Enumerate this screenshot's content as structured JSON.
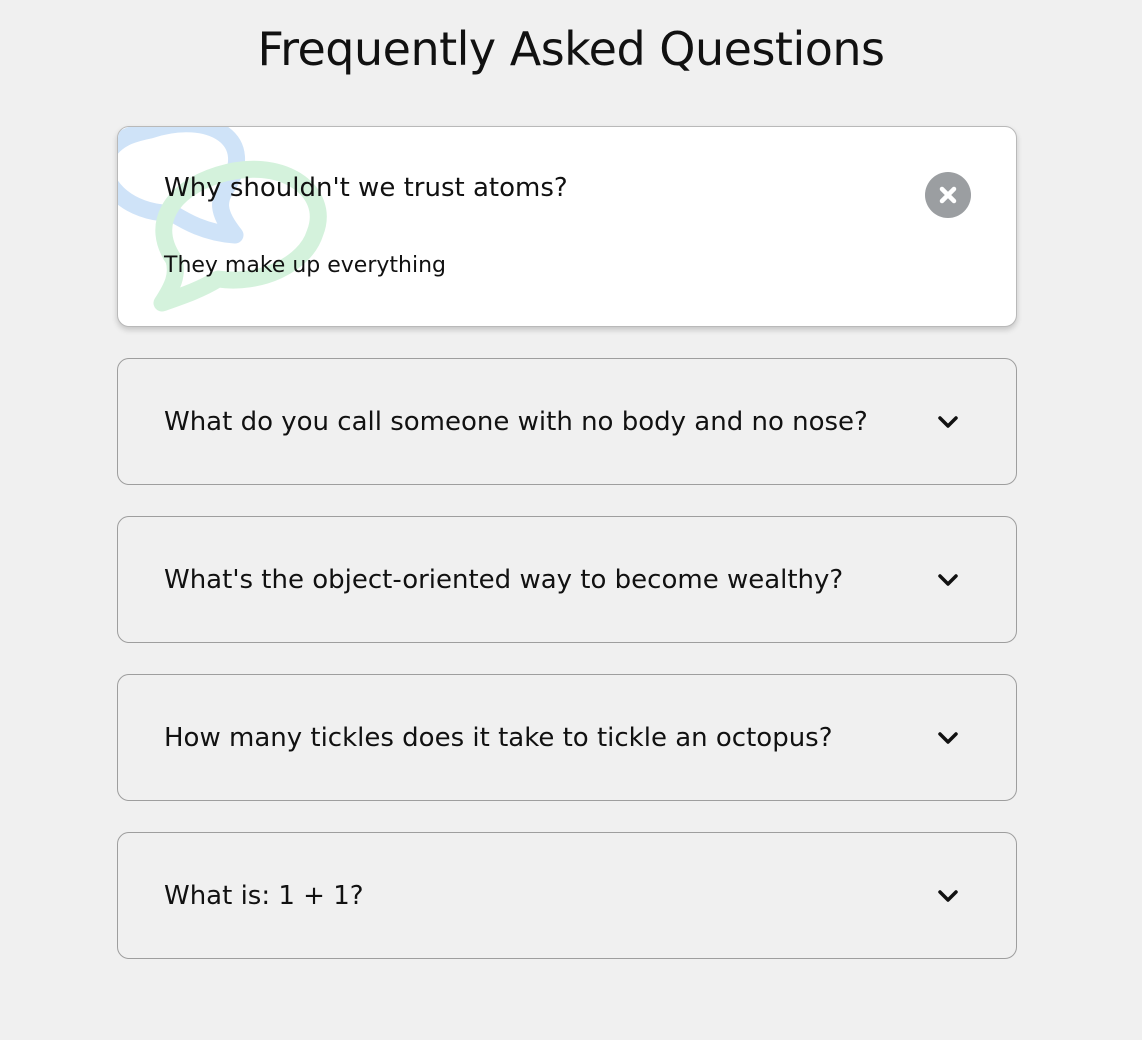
{
  "page": {
    "title": "Frequently Asked Questions"
  },
  "faqs": [
    {
      "question": "Why shouldn't we trust atoms?",
      "answer": "They make up everything",
      "expanded": true,
      "toggle_icon": "close-icon"
    },
    {
      "question": "What do you call someone with no body and no nose?",
      "expanded": false,
      "toggle_icon": "chevron-down-icon"
    },
    {
      "question": "What's the object-oriented way to become wealthy?",
      "expanded": false,
      "toggle_icon": "chevron-down-icon"
    },
    {
      "question": "How many tickles does it take to tickle an octopus?",
      "expanded": false,
      "toggle_icon": "chevron-down-icon"
    },
    {
      "question": "What is: 1 + 1?",
      "expanded": false,
      "toggle_icon": "chevron-down-icon"
    }
  ],
  "colors": {
    "page_background": "#f0f0f0",
    "active_card_background": "#ffffff",
    "card_border": "#9e9e9e",
    "close_button_background": "#9b9ea1",
    "bubble_blue": "#cfe3f8",
    "bubble_green": "#d4f2dc",
    "text": "#111111"
  },
  "decorations": {
    "active_card_background_icons": [
      "speech-bubble-icon",
      "speech-bubble-icon"
    ]
  }
}
